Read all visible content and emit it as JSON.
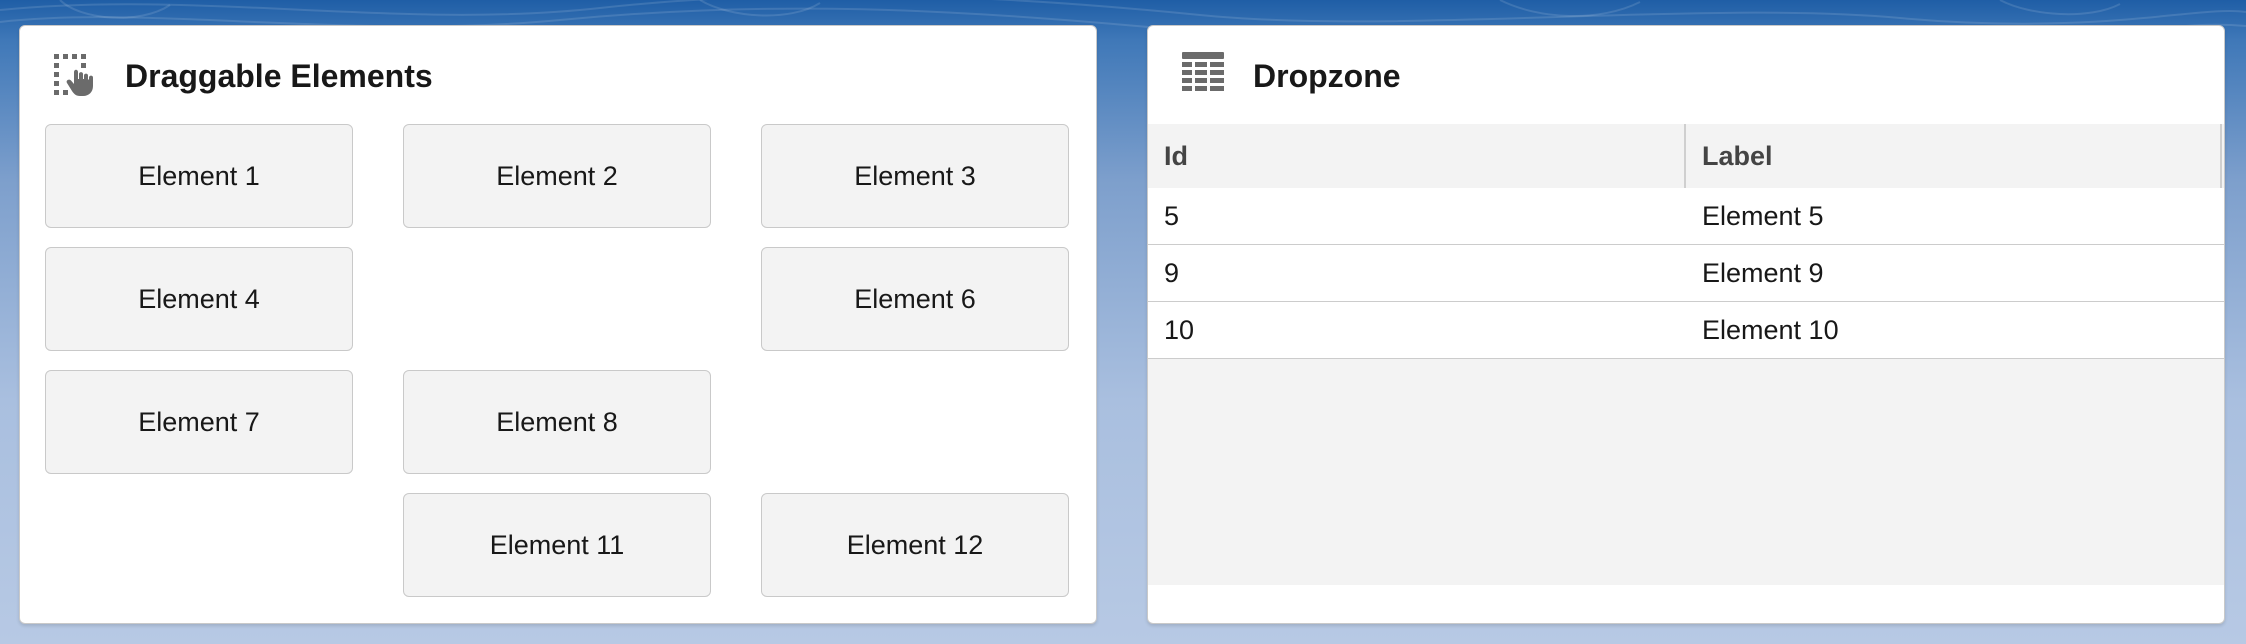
{
  "left_card": {
    "title": "Draggable Elements",
    "icon": "drag-drop-icon",
    "elements": [
      {
        "label": "Element 1"
      },
      {
        "label": "Element 2"
      },
      {
        "label": "Element 3"
      },
      {
        "label": "Element 4"
      },
      {
        "label": "Element 6"
      },
      {
        "label": "Element 7"
      },
      {
        "label": "Element 8"
      },
      {
        "label": "Element 11"
      },
      {
        "label": "Element 12"
      }
    ]
  },
  "right_card": {
    "title": "Dropzone",
    "icon": "table-icon",
    "table": {
      "columns": [
        "Id",
        "Label"
      ],
      "rows": [
        {
          "id": "5",
          "label": "Element 5"
        },
        {
          "id": "9",
          "label": "Element 9"
        },
        {
          "id": "10",
          "label": "Element 10"
        }
      ]
    }
  },
  "colors": {
    "background_top": "#1f5ea6",
    "background_bottom": "#b7c9e4",
    "card": "#ffffff",
    "tile": "#f3f3f3",
    "icon_gray": "#6b6b6b"
  }
}
